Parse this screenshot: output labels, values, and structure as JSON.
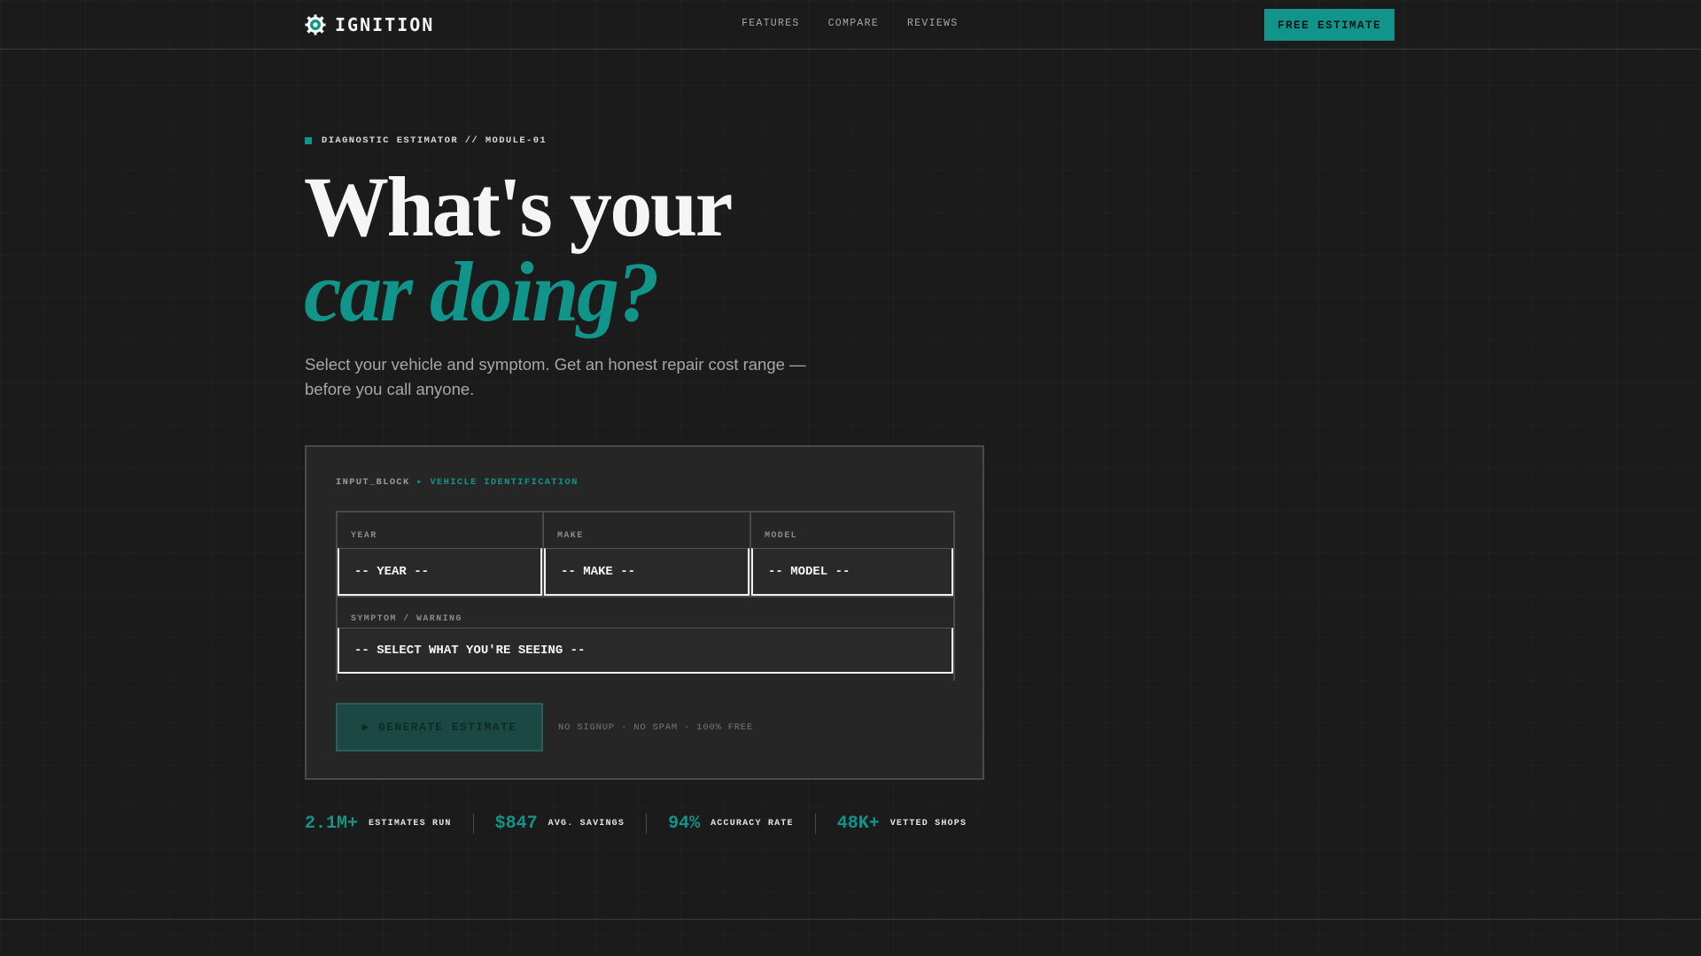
{
  "brand": {
    "name": "IGNITION",
    "icon": "gear-icon",
    "accent": "#11958a"
  },
  "nav": {
    "links": [
      "FEATURES",
      "COMPARE",
      "REVIEWS"
    ],
    "cta": "FREE ESTIMATE"
  },
  "hero": {
    "eyebrow": "DIAGNOSTIC ESTIMATOR // MODULE-01",
    "headline_line1": "What's your",
    "headline_line2": "car doing?",
    "subcopy": "Select your vehicle and symptom. Get an honest repair cost range — before you call anyone."
  },
  "panel": {
    "label_prefix": "INPUT_BLOCK",
    "label_suffix": "▸ VEHICLE IDENTIFICATION",
    "fields": {
      "year": {
        "label": "YEAR",
        "value": "-- YEAR --"
      },
      "make": {
        "label": "MAKE",
        "value": "-- MAKE --"
      },
      "model": {
        "label": "MODEL",
        "value": "-- MODEL --"
      },
      "symptom": {
        "label": "SYMPTOM / WARNING",
        "value": "-- SELECT WHAT YOU'RE SEEING --"
      }
    },
    "generate_button": "▶ GENERATE ESTIMATE",
    "note": "NO SIGNUP · NO SPAM · 100% FREE"
  },
  "stats": [
    {
      "value": "2.1M+",
      "label": "ESTIMATES RUN"
    },
    {
      "value": "$847",
      "label": "AVG. SAVINGS"
    },
    {
      "value": "94%",
      "label": "ACCURACY RATE"
    },
    {
      "value": "48K+",
      "label": "VETTED SHOPS"
    }
  ]
}
